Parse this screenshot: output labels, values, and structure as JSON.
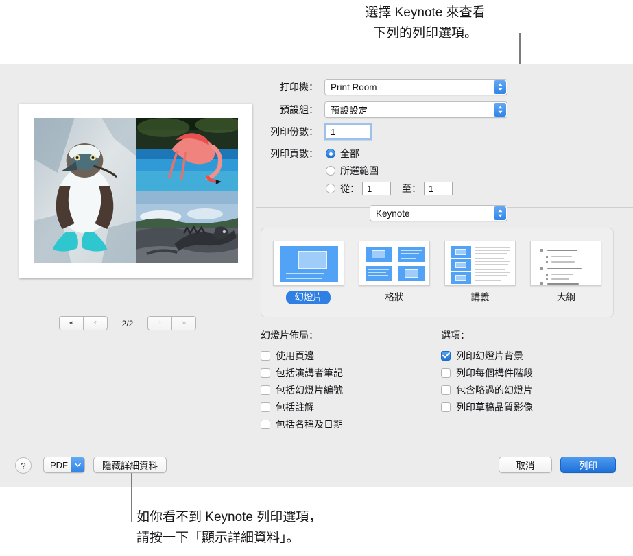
{
  "callouts": {
    "top": "選擇 Keynote 來查看\n下列的列印選項。",
    "bottom": "如你看不到 Keynote 列印選項，\n請按一下「顯示詳細資料」。"
  },
  "preview": {
    "photos": [
      {
        "name": "blue-footed-booby"
      },
      {
        "name": "flamingo"
      },
      {
        "name": "marine-iguana"
      }
    ],
    "nav": {
      "first_label": "«",
      "prev_label": "‹",
      "next_label": "›",
      "last_label": "»",
      "page_indicator": "2/2"
    }
  },
  "settings": {
    "printer": {
      "label": "打印機：",
      "value": "Print Room"
    },
    "presets": {
      "label": "預設組：",
      "value": "預設設定"
    },
    "copies": {
      "label": "列印份數：",
      "value": "1"
    },
    "pages": {
      "label": "列印頁數：",
      "options": [
        {
          "label": "全部",
          "selected": true
        },
        {
          "label": "所選範圍",
          "selected": false
        },
        {
          "label": "",
          "selected": false
        }
      ],
      "from_label": "從：",
      "from_value": "1",
      "to_label": "至：",
      "to_value": "1"
    },
    "module": {
      "value": "Keynote"
    }
  },
  "layout": {
    "items": [
      {
        "label": "幻燈片",
        "selected": true
      },
      {
        "label": "格狀",
        "selected": false
      },
      {
        "label": "講義",
        "selected": false
      },
      {
        "label": "大綱",
        "selected": false
      }
    ]
  },
  "slide_layout": {
    "title": "幻燈片佈局：",
    "items": [
      {
        "label": "使用頁邊",
        "checked": false
      },
      {
        "label": "包括演講者筆記",
        "checked": false
      },
      {
        "label": "包括幻燈片編號",
        "checked": false
      },
      {
        "label": "包括註解",
        "checked": false
      },
      {
        "label": "包括名稱及日期",
        "checked": false
      }
    ]
  },
  "options": {
    "title": "選項：",
    "items": [
      {
        "label": "列印幻燈片背景",
        "checked": true
      },
      {
        "label": "列印每個構件階段",
        "checked": false
      },
      {
        "label": "包含略過的幻燈片",
        "checked": false
      },
      {
        "label": "列印草稿品質影像",
        "checked": false
      }
    ]
  },
  "bottom_bar": {
    "help_label": "?",
    "pdf_label": "PDF",
    "hide_details_label": "隱藏詳細資料",
    "cancel_label": "取消",
    "print_label": "列印"
  },
  "colors": {
    "accent": "#2f7fe4",
    "dialog_bg": "#ececec",
    "text": "#16161a"
  }
}
